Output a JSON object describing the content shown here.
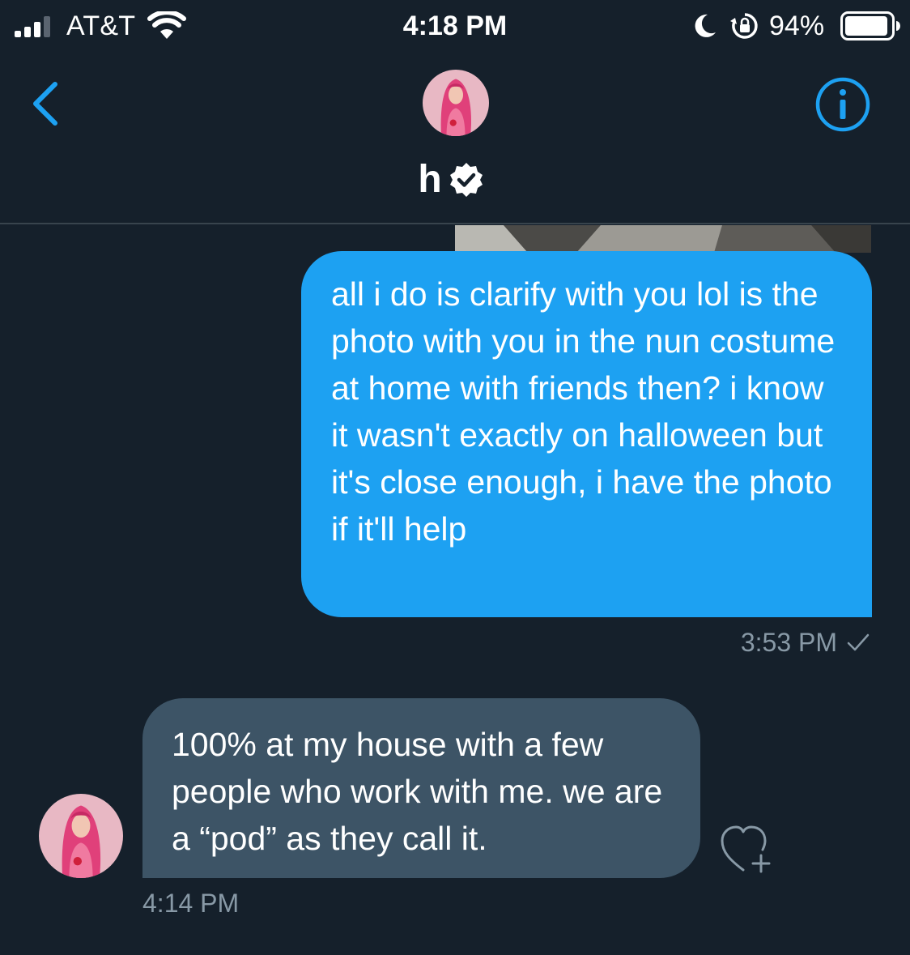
{
  "status_bar": {
    "carrier": "AT&T",
    "time": "4:18 PM",
    "battery_percent": "94%",
    "battery_level": 0.94,
    "icons": [
      "signal-icon",
      "wifi-icon",
      "moon-icon",
      "rotation-lock-icon",
      "battery-icon"
    ]
  },
  "header": {
    "back_icon": "chevron-left-icon",
    "contact_name": "h",
    "verified": true,
    "info_icon": "info-icon"
  },
  "messages": [
    {
      "direction": "sent",
      "text": "all i do is clarify with you lol is the photo with you in the nun costume at home with friends then? i know it wasn't exactly on halloween but it's close enough, i have the photo if it'll help",
      "time": "3:53 PM",
      "status_icon": "check-icon"
    },
    {
      "direction": "received",
      "text": "100% at my house with a few people who work with me. we are a “pod” as they call it.",
      "time": "4:14 PM",
      "reaction_icon": "heart-plus-icon"
    }
  ],
  "colors": {
    "background": "#15202b",
    "accent": "#1da1f2",
    "received_bubble": "#3d5466",
    "secondary_text": "#8899a6",
    "divider": "#38444d"
  }
}
